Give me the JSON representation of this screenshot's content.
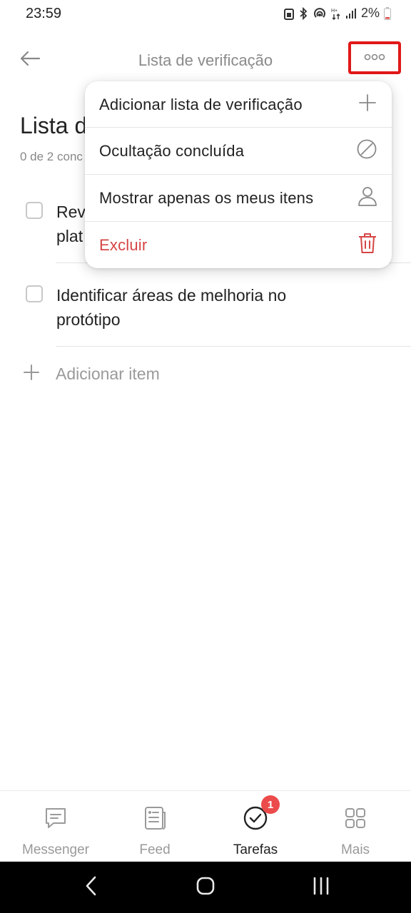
{
  "status_bar": {
    "time": "23:59",
    "battery": "2%"
  },
  "header": {
    "title": "Lista de verificação"
  },
  "page": {
    "title": "Lista d",
    "progress": "0 de 2 conc",
    "items": [
      {
        "line1": "Rev",
        "line2": "plat"
      },
      {
        "line1": "Identificar áreas de melhoria no",
        "line2": "protótipo"
      }
    ],
    "add_item_label": "Adicionar item"
  },
  "menu": {
    "items": [
      {
        "label": "Adicionar lista de verificação",
        "icon": "plus-icon"
      },
      {
        "label": "Ocultação concluída",
        "icon": "block-icon"
      },
      {
        "label": "Mostrar apenas os meus itens",
        "icon": "person-icon"
      },
      {
        "label": "Excluir",
        "icon": "trash-icon"
      }
    ],
    "danger_color": "#d64545"
  },
  "bottom_nav": {
    "items": [
      {
        "label": "Messenger",
        "icon": "chat-icon"
      },
      {
        "label": "Feed",
        "icon": "feed-icon"
      },
      {
        "label": "Tarefas",
        "icon": "check-circle-icon",
        "badge": "1"
      },
      {
        "label": "Mais",
        "icon": "grid-icon"
      }
    ],
    "active": "Tarefas"
  },
  "colors": {
    "accent_red": "#e01818",
    "badge_red": "#ec4b4b"
  }
}
